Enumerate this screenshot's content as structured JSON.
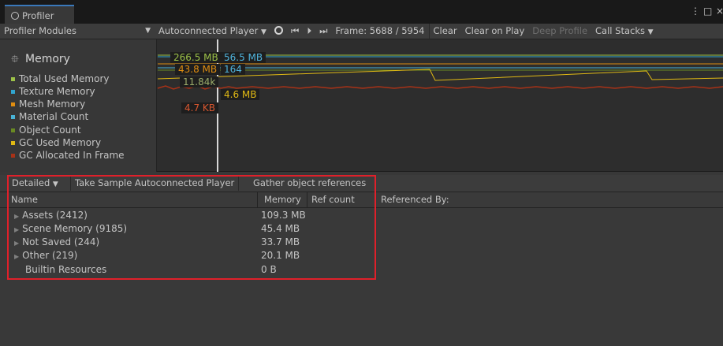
{
  "window": {
    "tab_title": "Profiler",
    "more_icon": "kebab-menu-icon",
    "maximize_icon": "maximize-icon",
    "close_icon": "close-icon"
  },
  "toolbar": {
    "modules_label": "Profiler Modules",
    "player_label": "Autoconnected Player",
    "frame_label": "Frame: 5688 / 5954",
    "clear": "Clear",
    "clear_on_play": "Clear on Play",
    "deep_profile": "Deep Profile",
    "call_stacks": "Call Stacks"
  },
  "module": {
    "title": "Memory",
    "legend": [
      {
        "label": "Total Used Memory",
        "color": "#9cc148"
      },
      {
        "label": "Texture Memory",
        "color": "#31a5cf"
      },
      {
        "label": "Mesh Memory",
        "color": "#e08d10"
      },
      {
        "label": "Material Count",
        "color": "#49b3d6"
      },
      {
        "label": "Object Count",
        "color": "#6a8a23"
      },
      {
        "label": "GC Used Memory",
        "color": "#e0b914"
      },
      {
        "label": "GC Allocated In Frame",
        "color": "#a83217"
      }
    ]
  },
  "chart_labels": {
    "total_used": "266.5 MB",
    "texture": "56.5 MB",
    "mesh": "43.8 MB",
    "material_count": "164",
    "object_count": "11.84k",
    "gc_used": "4.6 MB",
    "gc_alloc": "4.7 KB"
  },
  "detail": {
    "view_mode": "Detailed",
    "take_sample": "Take Sample Autoconnected Player",
    "gather": "Gather object references",
    "col_name": "Name",
    "col_memory": "Memory",
    "col_refcount": "Ref count",
    "referenced_by": "Referenced By:",
    "rows": [
      {
        "name": "Assets (2412)",
        "memory": "109.3 MB",
        "expandable": true
      },
      {
        "name": "Scene Memory (9185)",
        "memory": "45.4 MB",
        "expandable": true
      },
      {
        "name": "Not Saved (244)",
        "memory": "33.7 MB",
        "expandable": true
      },
      {
        "name": "Other (219)",
        "memory": "20.1 MB",
        "expandable": true
      },
      {
        "name": "Builtin Resources",
        "memory": "0 B",
        "expandable": false
      }
    ]
  }
}
